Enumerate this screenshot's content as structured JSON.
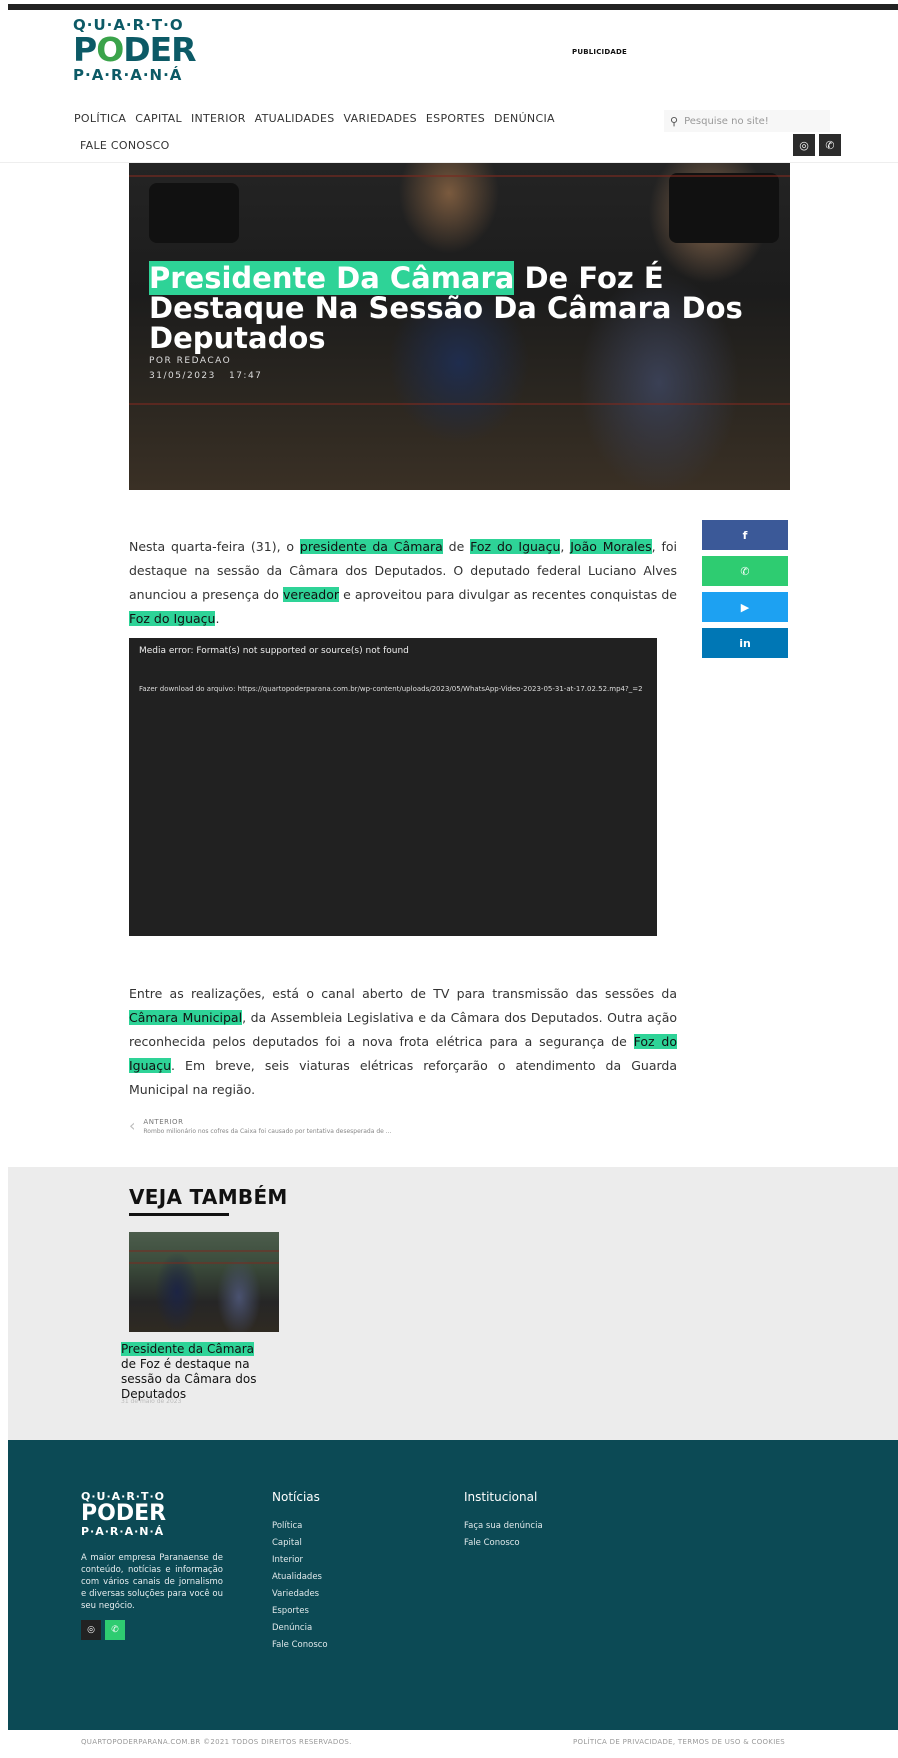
{
  "header": {
    "logo": {
      "line1": "Q·U·A·R·T·O",
      "line2_a": "P",
      "line2_o": "O",
      "line2_b": "DER",
      "line3": "P·A·R·A·N·Á"
    },
    "ad_label": "PUBLICIDADE",
    "nav": [
      "POLÍTICA",
      "CAPITAL",
      "INTERIOR",
      "ATUALIDADES",
      "VARIEDADES",
      "ESPORTES",
      "DENÚNCIA"
    ],
    "nav_second_row": "FALE CONOSCO",
    "search_placeholder": "Pesquise no site!",
    "social": [
      {
        "icon": "instagram-icon",
        "glyph": "◎"
      },
      {
        "icon": "whatsapp-icon",
        "glyph": "✆"
      }
    ]
  },
  "hero": {
    "title_highlight": "Presidente Da Câmara",
    "title_rest": "De Foz É Destaque Na Sessão Da Câmara Dos Deputados",
    "byline": "POR REDACAO",
    "date": "31/05/2023",
    "time": "17:47"
  },
  "article": {
    "p1": {
      "t1": "Nesta quarta-feira (31), o ",
      "h1": "presidente da Câmara",
      "t2": " de ",
      "h2": "Foz do Iguaçu",
      "t3": ", ",
      "h3": "João Morales",
      "t4": ", foi destaque na sessão da Câmara dos Deputados. O deputado federal Luciano Alves anunciou a presença do ",
      "h4": "vereador",
      "t5": " e aproveitou para divulgar as recentes conquistas de ",
      "h5": "Foz do Iguaçu",
      "t6": "."
    },
    "video": {
      "error": "Media error: Format(s) not supported or source(s) not found",
      "download": "Fazer download do arquivo: https://quartopoderparana.com.br/wp-content/uploads/2023/05/WhatsApp-Video-2023-05-31-at-17.02.52.mp4?_=2"
    },
    "p2": {
      "t1": "Entre as realizações, está o canal aberto de TV para transmissão das sessões da ",
      "h1": "Câmara Municipal",
      "t2": ", da Assembleia Legislativa e da Câmara dos Deputados. Outra ação reconhecida pelos deputados foi a nova frota elétrica para a segurança de ",
      "h2": "Foz do Iguaçu",
      "t3": ". Em breve, seis viaturas elétricas reforçarão o atendimento da Guarda Municipal na região."
    },
    "share": [
      {
        "icon": "facebook-icon",
        "glyph": "f",
        "color": "#3b5998"
      },
      {
        "icon": "whatsapp-icon",
        "glyph": "✆",
        "color": "#2ecc71"
      },
      {
        "icon": "twitter-icon",
        "glyph": "🐦",
        "color": "#1da1f2"
      },
      {
        "icon": "linkedin-icon",
        "glyph": "in",
        "color": "#0077b5"
      }
    ],
    "previous": {
      "label": "ANTERIOR",
      "title": "Rombo milionário nos cofres da Caixa foi causado por tentativa desesperada de ..."
    }
  },
  "related": {
    "heading": "VEJA TAMBÉM",
    "item": {
      "title_highlight": "Presidente da Câmara",
      "title_rest": "de Foz é destaque na sessão da Câmara dos Deputados",
      "date": "31 de maio de 2023"
    }
  },
  "footer": {
    "logo": {
      "line1": "Q·U·A·R·T·O",
      "line2": "PODER",
      "line3": "P·A·R·A·N·Á"
    },
    "description": "A maior empresa Paranaense de conteúdo, notícias e informação com vários canais de jornalismo e diversas soluções para você ou seu negócio.",
    "news_heading": "Notícias",
    "news_links": [
      "Política",
      "Capital",
      "Interior",
      "Atualidades",
      "Variedades",
      "Esportes",
      "Denúncia",
      "Fale Conosco"
    ],
    "inst_heading": "Institucional",
    "inst_links": [
      "Faça sua denúncia",
      "Fale Conosco"
    ],
    "copyright": "QUARTOPODERPARANA.COM.BR ©2021 TODOS DIREITOS RESERVADOS.",
    "legal": "POLÍTICA DE PRIVACIDADE, TERMOS DE USO & COOKIES"
  },
  "colors": {
    "accent": "#2ed397",
    "footer_bg": "#0c4a55",
    "brand_green": "#6bbf4a"
  }
}
